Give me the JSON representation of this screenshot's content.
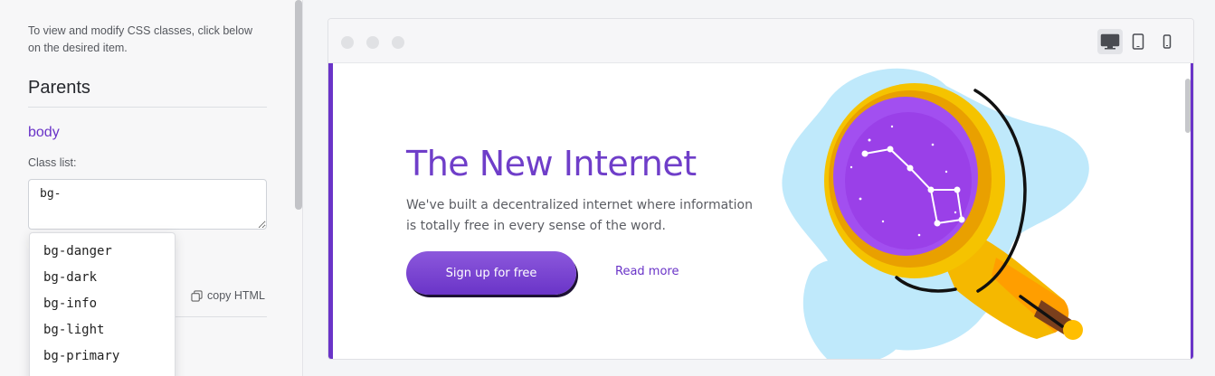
{
  "panel": {
    "hint": "To view and modify CSS classes, click below on the desired item.",
    "parents_heading": "Parents",
    "parent_link": "body",
    "class_list_label": "Class list:",
    "class_list_value": "bg-",
    "copy_html": "copy HTML",
    "suggestions": [
      "bg-danger",
      "bg-dark",
      "bg-info",
      "bg-light",
      "bg-primary"
    ]
  },
  "devices": [
    {
      "name": "desktop-icon",
      "active": true
    },
    {
      "name": "tablet-icon",
      "active": false
    },
    {
      "name": "mobile-icon",
      "active": false
    }
  ],
  "hero": {
    "title": "The New Internet",
    "text": "We've built a decentralized internet where information is totally free in every sense of the word.",
    "cta": "Sign up for free",
    "link": "Read more"
  },
  "colors": {
    "accent": "#6a34c8",
    "title": "#6f3ec9",
    "illus_blue": "#bfe9fb",
    "illus_gold": "#f5b800",
    "illus_purple": "#a24ff0"
  }
}
